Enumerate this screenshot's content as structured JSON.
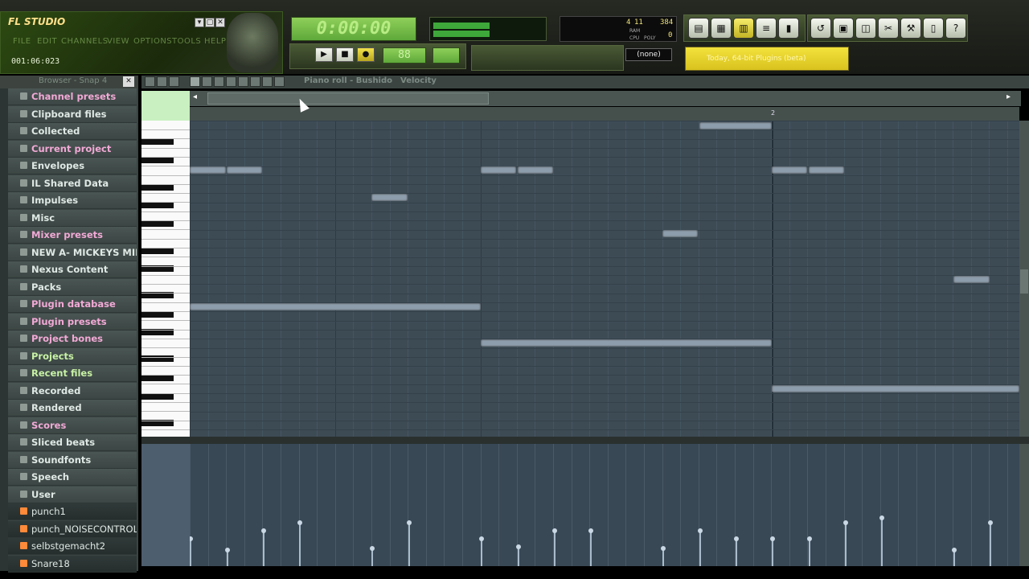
{
  "app": {
    "title": "FL STUDIO",
    "menu": [
      "FILE",
      "EDIT",
      "CHANNELS",
      "VIEW",
      "OPTIONS",
      "TOOLS",
      "HELP"
    ],
    "time_readout": "001:06:023",
    "window_buttons": [
      "▾",
      "▢",
      "✕"
    ]
  },
  "transport": {
    "song_time": "0:00:00",
    "play": "▶",
    "stop": "■",
    "record": "●",
    "tempo_lcd": "88",
    "pattern_lcd": "",
    "pattern_select": "(none)"
  },
  "cpu": {
    "values": [
      "4",
      "11",
      "384",
      "0"
    ],
    "labels": [
      "RAM",
      "CPU",
      "POLY"
    ]
  },
  "hint": "Today, 64-bit Plugins (beta)",
  "toolbar_icons": [
    "playlist-icon",
    "step-sequencer-icon",
    "piano-roll-icon",
    "browser-icon",
    "mixer-icon",
    "undo-icon",
    "save-icon",
    "render-icon",
    "cut-icon",
    "tools-icon",
    "notes-icon",
    "help-icon"
  ],
  "browser": {
    "title": "Browser - Snap 4",
    "close": "✕",
    "items": [
      {
        "label": "Channel presets",
        "style": "pink"
      },
      {
        "label": "Clipboard files",
        "style": "normal"
      },
      {
        "label": "Collected",
        "style": "normal"
      },
      {
        "label": "Current project",
        "style": "pink"
      },
      {
        "label": "Envelopes",
        "style": "normal"
      },
      {
        "label": "IL Shared Data",
        "style": "normal"
      },
      {
        "label": "Impulses",
        "style": "normal"
      },
      {
        "label": "Misc",
        "style": "normal"
      },
      {
        "label": "Mixer presets",
        "style": "pink"
      },
      {
        "label": "NEW A- MICKEYS MIDI ...",
        "style": "normal"
      },
      {
        "label": "Nexus Content",
        "style": "normal"
      },
      {
        "label": "Packs",
        "style": "normal"
      },
      {
        "label": "Plugin database",
        "style": "pink"
      },
      {
        "label": "Plugin presets",
        "style": "pink"
      },
      {
        "label": "Project bones",
        "style": "pink"
      },
      {
        "label": "Projects",
        "style": "green"
      },
      {
        "label": "Recent files",
        "style": "green"
      },
      {
        "label": "Recorded",
        "style": "normal"
      },
      {
        "label": "Rendered",
        "style": "normal"
      },
      {
        "label": "Scores",
        "style": "pink"
      },
      {
        "label": "Sliced beats",
        "style": "normal"
      },
      {
        "label": "Soundfonts",
        "style": "normal"
      },
      {
        "label": "Speech",
        "style": "normal"
      },
      {
        "label": "User",
        "style": "normal"
      },
      {
        "label": "punch1",
        "style": "file"
      },
      {
        "label": "punch_NOISECONTROLL",
        "style": "file"
      },
      {
        "label": "selbstgemacht2",
        "style": "file"
      },
      {
        "label": "Snare18",
        "style": "file"
      }
    ]
  },
  "piano_roll": {
    "title": "Piano roll - Bushido",
    "target": "Velocity",
    "bar_marker": "2"
  }
}
